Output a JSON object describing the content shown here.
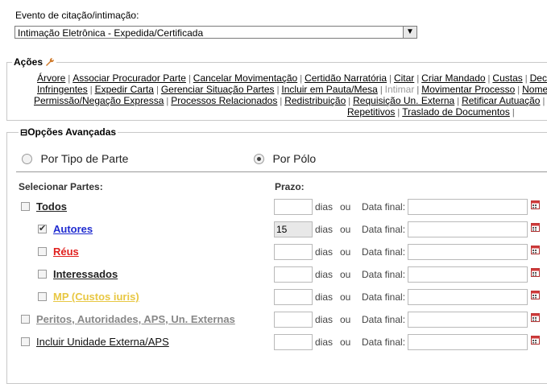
{
  "evento": {
    "label": "Evento de citação/intimação:",
    "selected": "Intimação Eletrônica - Expedida/Certificada"
  },
  "acoes": {
    "legend": "Ações",
    "rows": [
      [
        "Árvore",
        "Associar Procurador Parte",
        "Cancelar Movimentação",
        "Certidão Narratória",
        "Citar",
        "Criar Mandado",
        "Custas",
        "Decli"
      ],
      [
        "Infringentes",
        "Expedir Carta",
        "Gerenciar Situação Partes",
        "Incluir em Pauta/Mesa",
        "Intimar",
        "Movimentar Processo",
        "Nome"
      ],
      [
        "Permissão/Negação Expressa",
        "Processos Relacionados",
        "Redistribuição",
        "Requisição Un. Externa",
        "Retificar Autuação",
        "S"
      ],
      [
        "Repetitivos",
        "Traslado de Documentos"
      ]
    ],
    "disabled": [
      "Intimar"
    ]
  },
  "opcoes": {
    "legend": "Opções Avançadas",
    "toggle": "⊟",
    "radio_tipo": "Por Tipo de Parte",
    "radio_polo": "Por Pólo",
    "selected_radio": "Por Pólo",
    "col_partes": "Selecionar Partes:",
    "col_prazo": "Prazo:",
    "dias": "dias",
    "ou": "ou",
    "data_final": "Data final:"
  },
  "parties": [
    {
      "label": "Todos",
      "checked": false,
      "prazo": "",
      "color": "#222222"
    },
    {
      "label": "Autores",
      "checked": true,
      "prazo": "15",
      "color": "#1f2bd0"
    },
    {
      "label": "Réus",
      "checked": false,
      "prazo": "",
      "color": "#e0201e"
    },
    {
      "label": "Interessados",
      "checked": false,
      "prazo": "",
      "color": "#222222"
    },
    {
      "label": "MP (Custos iuris)",
      "checked": false,
      "prazo": "",
      "color": "#e8c742"
    },
    {
      "label": "Peritos, Autoridades, APS, Un. Externas",
      "checked": false,
      "prazo": "",
      "color": "#888888"
    },
    {
      "label": "Incluir Unidade Externa/APS",
      "checked": false,
      "prazo": "",
      "color": "#111111"
    }
  ]
}
